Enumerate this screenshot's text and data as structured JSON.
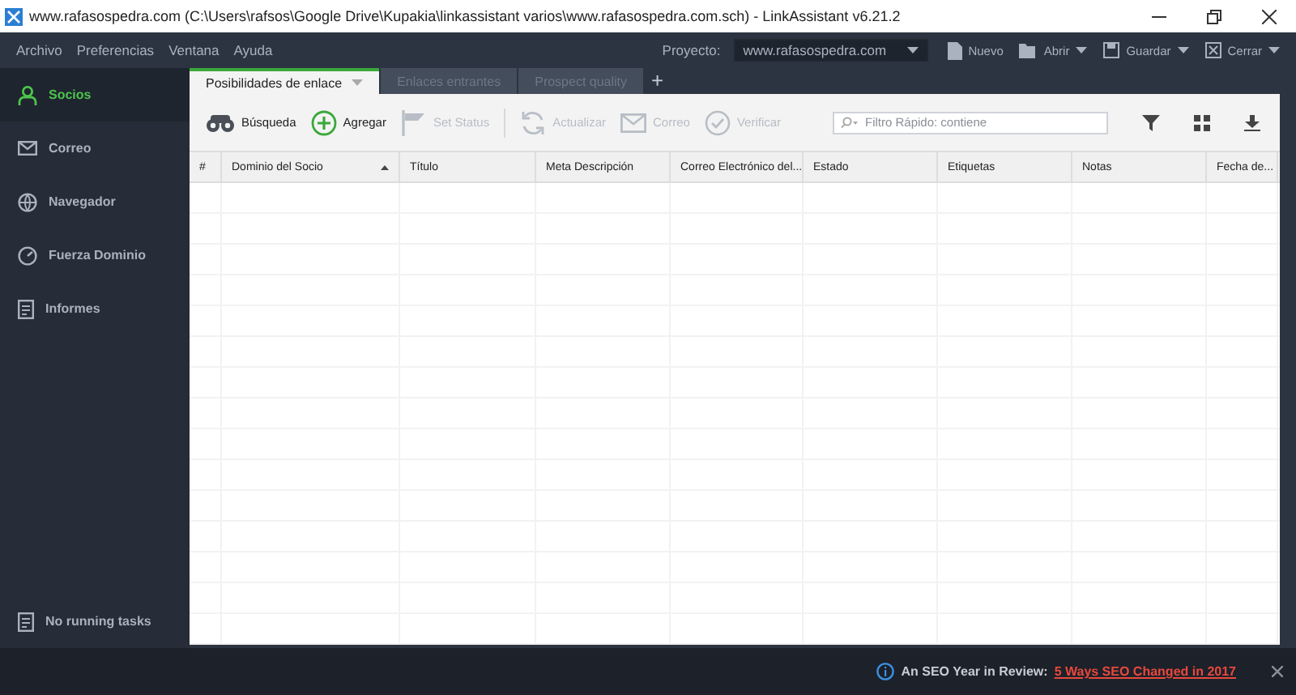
{
  "window": {
    "title": "www.rafasospedra.com (C:\\Users\\rafsos\\Google Drive\\Kupakia\\linkassistant varios\\www.rafasospedra.com.sch) - LinkAssistant v6.21.2"
  },
  "menu": [
    "Archivo",
    "Preferencias",
    "Ventana",
    "Ayuda"
  ],
  "project": {
    "label": "Proyecto:",
    "value": "www.rafasospedra.com"
  },
  "top_actions": [
    {
      "kind": "new",
      "label": "Nuevo",
      "dropdown": false
    },
    {
      "kind": "open",
      "label": "Abrir",
      "dropdown": true
    },
    {
      "kind": "save",
      "label": "Guardar",
      "dropdown": true
    },
    {
      "kind": "close",
      "label": "Cerrar",
      "dropdown": true
    }
  ],
  "sidebar": {
    "items": [
      {
        "kind": "partners",
        "label": "Socios",
        "selected": true
      },
      {
        "kind": "mail",
        "label": "Correo",
        "selected": false
      },
      {
        "kind": "browser",
        "label": "Navegador",
        "selected": false
      },
      {
        "kind": "strength",
        "label": "Fuerza Dominio",
        "selected": false
      },
      {
        "kind": "reports",
        "label": "Informes",
        "selected": false
      }
    ],
    "tasks": "No running tasks"
  },
  "tabs": [
    {
      "label": "Posibilidades de enlace",
      "selected": true
    },
    {
      "label": "Enlaces entrantes",
      "selected": false
    },
    {
      "label": "Prospect quality",
      "selected": false
    }
  ],
  "add_tab": "+",
  "toolbar": [
    {
      "kind": "search",
      "label": "Búsqueda",
      "disabled": false
    },
    {
      "kind": "add",
      "label": "Agregar",
      "disabled": false
    },
    {
      "kind": "flag",
      "label": "Set Status",
      "disabled": true
    },
    {
      "kind": "refresh",
      "label": "Actualizar",
      "disabled": true
    },
    {
      "kind": "mail",
      "label": "Correo",
      "disabled": true
    },
    {
      "kind": "verify",
      "label": "Verificar",
      "disabled": true
    }
  ],
  "filter": {
    "placeholder": "Filtro Rápido: contiene"
  },
  "table": {
    "columns": [
      {
        "label": "#",
        "sorted": false
      },
      {
        "label": "Dominio del Socio",
        "sorted": true
      },
      {
        "label": "Título",
        "sorted": false
      },
      {
        "label": "Meta Descripción",
        "sorted": false
      },
      {
        "label": "Correo Electrónico del...",
        "sorted": false
      },
      {
        "label": "Estado",
        "sorted": false
      },
      {
        "label": "Etiquetas",
        "sorted": false
      },
      {
        "label": "Notas",
        "sorted": false
      },
      {
        "label": "Fecha de...",
        "sorted": false
      }
    ]
  },
  "notification": {
    "text": "An SEO Year in Review:",
    "link": "5 Ways SEO Changed in 2017"
  }
}
